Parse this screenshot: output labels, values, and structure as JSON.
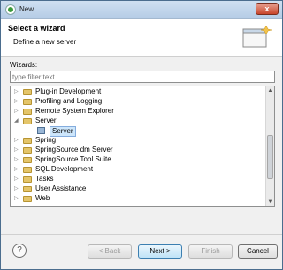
{
  "window": {
    "title": "New",
    "close_glyph": "x"
  },
  "banner": {
    "title": "Select a wizard",
    "subtitle": "Define a new server"
  },
  "wizards_label": "Wizards:",
  "filter": {
    "placeholder": "type filter text"
  },
  "tree": [
    {
      "label": "Plug-in Development",
      "state": "collapsed",
      "icon": "folder-icon"
    },
    {
      "label": "Profiling and Logging",
      "state": "collapsed",
      "icon": "folder-icon"
    },
    {
      "label": "Remote System Explorer",
      "state": "collapsed",
      "icon": "folder-icon"
    },
    {
      "label": "Server",
      "state": "expanded",
      "icon": "folder-icon"
    },
    {
      "label": "Server",
      "state": "leaf",
      "icon": "server-icon",
      "selected": true
    },
    {
      "label": "Spring",
      "state": "collapsed",
      "icon": "folder-icon"
    },
    {
      "label": "SpringSource dm Server",
      "state": "collapsed",
      "icon": "folder-icon"
    },
    {
      "label": "SpringSource Tool Suite",
      "state": "collapsed",
      "icon": "folder-icon"
    },
    {
      "label": "SQL Development",
      "state": "collapsed",
      "icon": "folder-icon"
    },
    {
      "label": "Tasks",
      "state": "collapsed",
      "icon": "folder-icon"
    },
    {
      "label": "User Assistance",
      "state": "collapsed",
      "icon": "folder-icon"
    },
    {
      "label": "Web",
      "state": "collapsed",
      "icon": "folder-icon"
    }
  ],
  "footer": {
    "help_glyph": "?",
    "back_label": "< Back",
    "next_label": "Next >",
    "finish_label": "Finish",
    "cancel_label": "Cancel"
  }
}
